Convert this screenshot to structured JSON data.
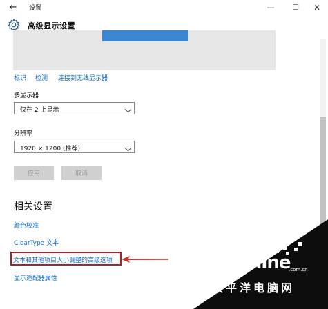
{
  "window": {
    "back_icon": "arrow-left-icon",
    "title": "设置",
    "controls": [
      "minimize-icon",
      "maximize-icon",
      "close-icon"
    ]
  },
  "header": {
    "icon": "gear-icon",
    "title": "高级显示设置"
  },
  "display_links": {
    "identify": "标识",
    "detect": "检测",
    "wireless": "连接到无线显示器"
  },
  "multiple_displays": {
    "label": "多显示器",
    "value": "仅在 2 上显示"
  },
  "resolution": {
    "label": "分辨率",
    "value": "1920 × 1200 (推荐)"
  },
  "buttons": {
    "apply": "应用",
    "cancel": "取消"
  },
  "related": {
    "heading": "相关设置",
    "color_calibration": "颜色校准",
    "cleartype": "ClearType 文本",
    "advanced_text_sizing": "文本和其他项目大小调整的高级选项",
    "adapter_properties": "显示适配器属性"
  },
  "logo": {
    "name": "PConline",
    "domain": ".com.cn",
    "subtitle": "太平洋电脑网"
  },
  "colors": {
    "accent": "#0a63b8",
    "highlight": "#a3222b",
    "preview_monitor": "#3a86d1"
  }
}
